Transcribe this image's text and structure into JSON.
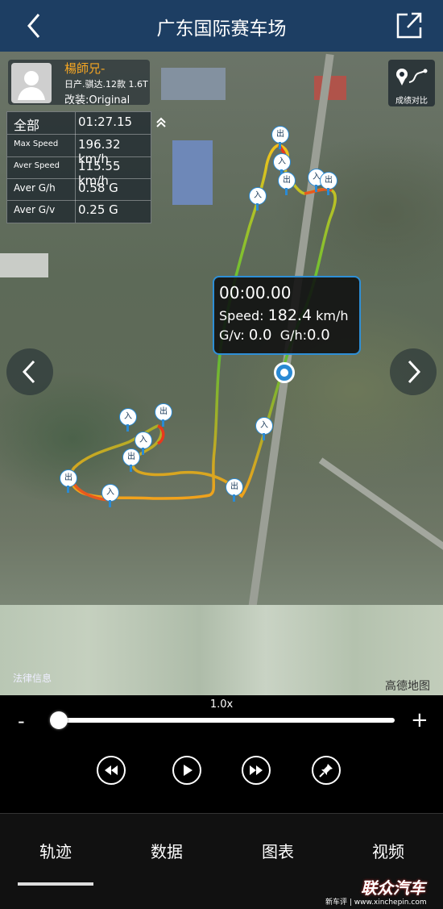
{
  "header": {
    "title": "广东国际赛车场"
  },
  "driver": {
    "name": "楊師兄-",
    "car": "日产.骐达.12款 1.6T",
    "mod": "改装:Original"
  },
  "stats": [
    {
      "label": "全部",
      "value": "01:27.15"
    },
    {
      "label": "Max Speed",
      "value": "196.32 km/h"
    },
    {
      "label": "Aver Speed",
      "value": "115.55 km/h"
    },
    {
      "label": "Aver G/h",
      "value": "0.58 G"
    },
    {
      "label": "Aver G/v",
      "value": "0.25 G"
    }
  ],
  "compare": {
    "label": "成绩对比"
  },
  "popup": {
    "time": "00:00.00",
    "speed_label": "Speed:",
    "speed_value": "182.4",
    "speed_unit": "km/h",
    "gv_label": "G/v:",
    "gv_value": "0.0",
    "gh_label": "G/h:",
    "gh_value": "0.0"
  },
  "pins": {
    "exit": "出",
    "enter": "入"
  },
  "map": {
    "legal": "法律信息",
    "provider": "高德地图"
  },
  "playback": {
    "speed": "1.0x",
    "minus": "-",
    "plus": "+",
    "progress": 0.02
  },
  "tabs": [
    "轨迹",
    "数据",
    "图表",
    "视频"
  ],
  "watermark": {
    "brand": "联众汽车",
    "sub": "新车评 | www.xinchepin.com"
  },
  "colors": {
    "header_bg": "#1d3e63",
    "accent": "#2a8ad4",
    "driver_name": "#f5a623"
  }
}
